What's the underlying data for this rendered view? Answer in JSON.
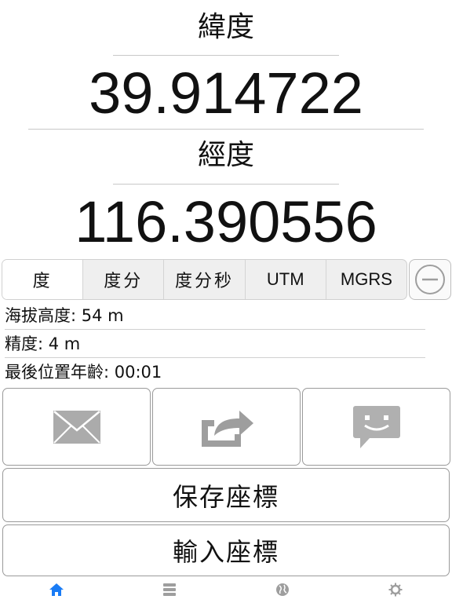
{
  "latitude": {
    "label": "緯度",
    "value": "39.914722"
  },
  "longitude": {
    "label": "經度",
    "value": "116.390556"
  },
  "format_segments": [
    {
      "label": "度",
      "selected": true
    },
    {
      "label": "度分",
      "selected": false
    },
    {
      "label": "度分秒",
      "selected": false
    },
    {
      "label": "UTM",
      "selected": false
    },
    {
      "label": "MGRS",
      "selected": false
    }
  ],
  "info": {
    "altitude": "海拔高度: 54 m",
    "accuracy": "精度: 4 m",
    "last_position_age": "最後位置年齡: 00:01"
  },
  "actions": {
    "email_icon": "envelope-icon",
    "share_icon": "share-arrow-icon",
    "message_icon": "chat-bubble-icon",
    "save_label": "保存座標",
    "input_label": "輸入座標"
  },
  "tabs": [
    {
      "icon": "home-icon",
      "active": true
    },
    {
      "icon": "list-icon",
      "active": false
    },
    {
      "icon": "globe-icon",
      "active": false
    },
    {
      "icon": "gear-icon",
      "active": false
    }
  ],
  "colors": {
    "accent": "#1a7cf5",
    "icon_gray": "#9e9e9e"
  }
}
